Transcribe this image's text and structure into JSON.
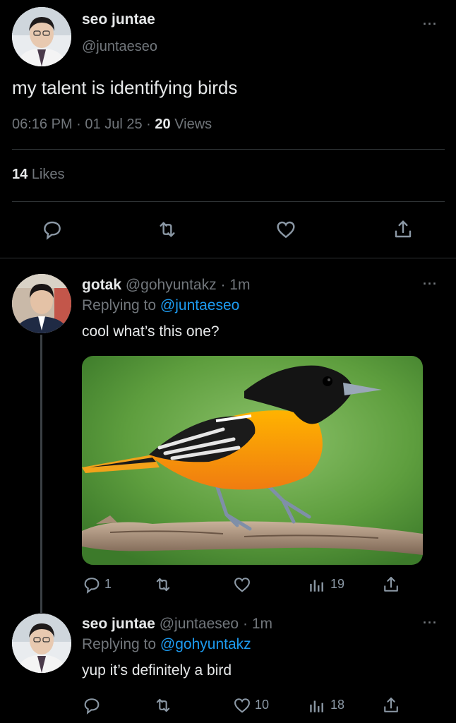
{
  "main_tweet": {
    "author_name": "seo juntae",
    "handle": "@juntaeseo",
    "text": "my talent is identifying birds",
    "time": "06:16 PM",
    "sep1": "·",
    "date": "01 Jul 25",
    "sep2": "·",
    "views_count": "20",
    "views_label": "Views",
    "likes_count": "14",
    "likes_label": "Likes",
    "more": "···"
  },
  "reply1": {
    "author_name": "gotak",
    "handle": "@gohyuntakz",
    "sep": "·",
    "time": "1m",
    "replying_prefix": "Replying to",
    "replying_handle": "@juntaeseo",
    "text": "cool what’s this one?",
    "image_icon": "oriole-bird-photo",
    "reply_count": "1",
    "retweet_count": "",
    "like_count": "",
    "views_count": "19",
    "more": "···"
  },
  "reply2": {
    "author_name": "seo juntae",
    "handle": "@juntaeseo",
    "sep": "·",
    "time": "1m",
    "replying_prefix": "Replying to",
    "replying_handle": "@gohyuntakz",
    "text": "yup it’s definitely a bird",
    "reply_count": "",
    "retweet_count": "",
    "like_count": "10",
    "views_count": "18",
    "more": "···"
  },
  "colors": {
    "background": "#000000",
    "text": "#e7e9ea",
    "muted": "#71767b",
    "link": "#1d9bf0",
    "divider": "#2f3336"
  }
}
